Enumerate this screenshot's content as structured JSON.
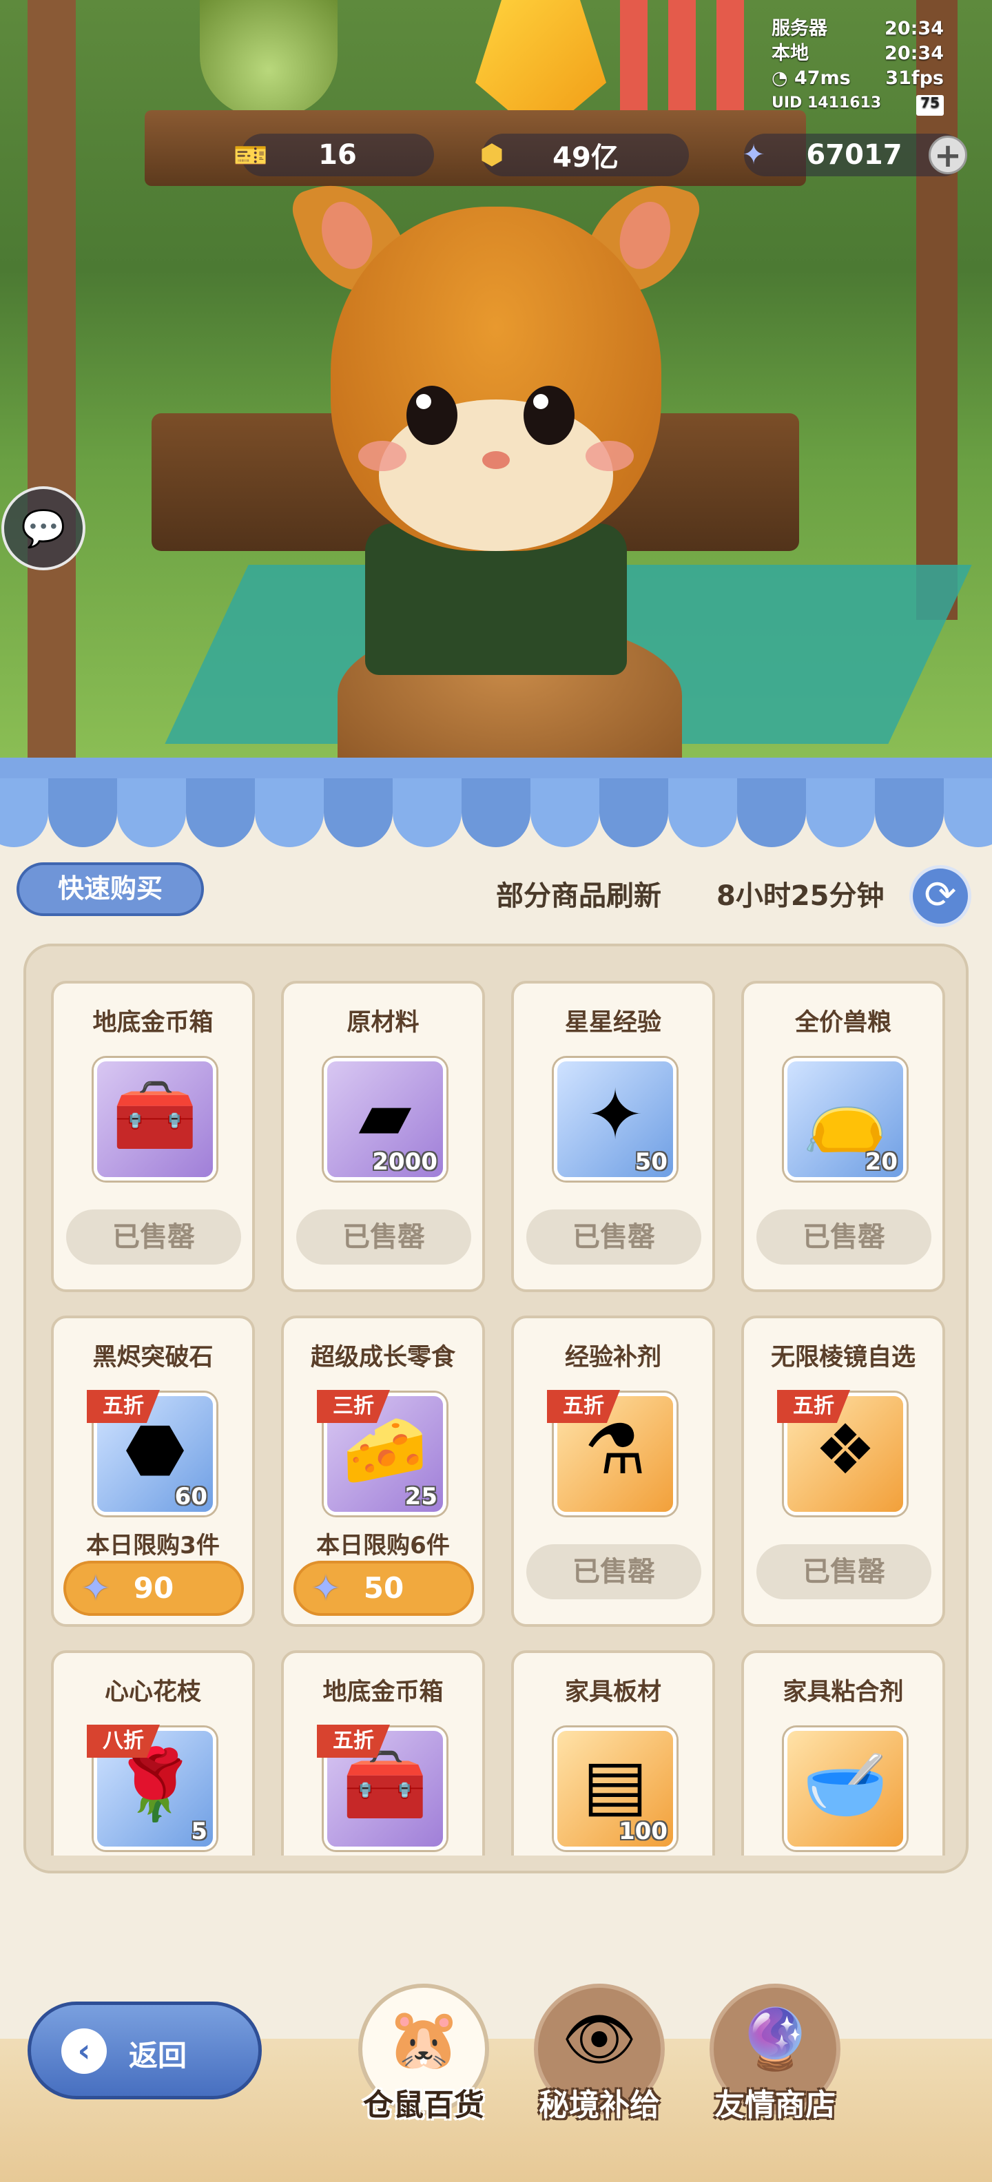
{
  "status": {
    "server_label": "服务器",
    "server_time": "20:34",
    "local_label": "本地",
    "local_time": "20:34",
    "ping": "47ms",
    "fps": "31fps",
    "uid_label": "UID",
    "uid": "1411613",
    "battery": "75"
  },
  "currencies": {
    "ticket": "16",
    "coins": "49亿",
    "stars": "67017"
  },
  "shop": {
    "quick_buy": "快速购买",
    "refresh_label": "部分商品刷新",
    "refresh_time": "8小时25分钟"
  },
  "items": [
    {
      "name": "地底金币箱",
      "qty": "",
      "status": "已售罄",
      "icon": "chest-icon"
    },
    {
      "name": "原材料",
      "qty": "2000",
      "status": "已售罄",
      "icon": "ingot-icon"
    },
    {
      "name": "星星经验",
      "qty": "50",
      "status": "已售罄",
      "icon": "star-card-icon"
    },
    {
      "name": "全价兽粮",
      "qty": "20",
      "status": "已售罄",
      "icon": "food-bag-icon"
    },
    {
      "name": "黑烬突破石",
      "qty": "60",
      "discount": "五折",
      "limit": "本日限购3件",
      "price": "90",
      "icon": "ore-icon"
    },
    {
      "name": "超级成长零食",
      "qty": "25",
      "discount": "三折",
      "limit": "本日限购6件",
      "price": "50",
      "icon": "cheese-icon"
    },
    {
      "name": "经验补剂",
      "qty": "",
      "discount": "五折",
      "status": "已售罄",
      "icon": "potion-icon"
    },
    {
      "name": "无限棱镜自选",
      "qty": "",
      "discount": "五折",
      "status": "已售罄",
      "icon": "prism-cube-icon"
    },
    {
      "name": "心心花枝",
      "qty": "5",
      "discount": "八折",
      "icon": "rose-icon"
    },
    {
      "name": "地底金币箱",
      "qty": "",
      "discount": "五折",
      "icon": "chest-icon"
    },
    {
      "name": "家具板材",
      "qty": "100",
      "icon": "planks-icon"
    },
    {
      "name": "家具粘合剂",
      "qty": "",
      "icon": "glue-bowl-icon"
    }
  ],
  "nav": {
    "back": "返回",
    "tab1": "仓鼠百货",
    "tab2": "秘境补给",
    "tab3": "友情商店"
  },
  "colors": {
    "accent_blue": "#6f95d8",
    "price_orange": "#f1a93e",
    "discount_red": "#d8432f"
  }
}
